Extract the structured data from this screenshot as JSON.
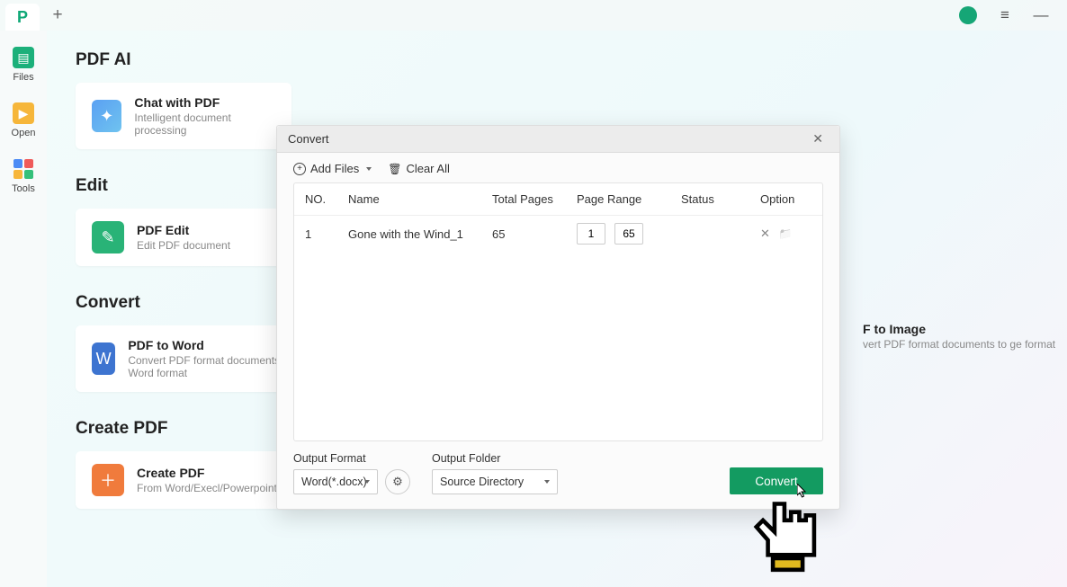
{
  "titlebar": {
    "plus": "+",
    "menu": "≡",
    "minimize": "—"
  },
  "sidebar": {
    "files": "Files",
    "open": "Open",
    "tools": "Tools"
  },
  "sections": {
    "pdfai_title": "PDF AI",
    "edit_title": "Edit",
    "convert_title": "Convert",
    "create_title": "Create PDF"
  },
  "cards": {
    "chat": {
      "title": "Chat with PDF",
      "sub": "Intelligent document processing"
    },
    "edit": {
      "title": "PDF Edit",
      "sub": "Edit PDF document"
    },
    "word": {
      "title": "PDF to Word",
      "sub": "Convert PDF format documents to Word format"
    },
    "image": {
      "title": "F to Image",
      "sub": "vert PDF format documents to ge format"
    },
    "create": {
      "title": "Create PDF",
      "sub": "From Word/Execl/Powerpoint/Imag"
    }
  },
  "modal": {
    "title": "Convert",
    "add_files": "Add Files",
    "clear_all": "Clear All",
    "cols": {
      "no": "NO.",
      "name": "Name",
      "total": "Total Pages",
      "range": "Page Range",
      "status": "Status",
      "option": "Option"
    },
    "rows": [
      {
        "no": "1",
        "name": "Gone with the Wind_1",
        "total": "65",
        "range_from": "1",
        "range_to": "65"
      }
    ],
    "output_format_label": "Output Format",
    "output_format_value": "Word(*.docx)",
    "output_folder_label": "Output Folder",
    "output_folder_value": "Source Directory",
    "convert_btn": "Convert"
  }
}
